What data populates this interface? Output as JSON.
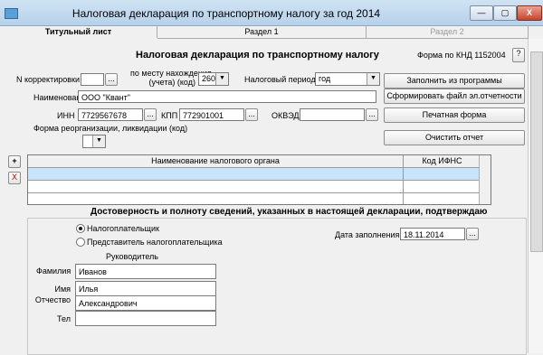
{
  "window": {
    "title": "Налоговая декларация по транспортному налогу за год 2014",
    "buttons": {
      "minimize": "—",
      "restore": "▢",
      "close": "X"
    }
  },
  "tabs": [
    {
      "label": "Титульный лист",
      "state": "active"
    },
    {
      "label": "Раздел 1",
      "state": "normal"
    },
    {
      "label": "Раздел 2",
      "state": "disabled"
    }
  ],
  "form": {
    "heading": "Налоговая декларация по транспортному налогу",
    "knd": "Форма по КНД 1152004",
    "help_label": "?",
    "n_corr_label": "N корректировки",
    "n_corr_value": "",
    "ellipsis": "...",
    "location_label_1": "по месту нахождения",
    "location_label_2": "(учета) (код)",
    "location_value": "260",
    "period_label": "Налоговый период",
    "period_value": "год",
    "name_label": "Наименование",
    "name_value": "ООО \"Квант\"",
    "inn_label": "ИНН",
    "inn_value": "7729567678",
    "kpp_label": "КПП",
    "kpp_value": "772901001",
    "okved_label": "ОКВЭД",
    "okved_value": "",
    "reorg_label": "Форма реорганизации, ликвидации (код)",
    "reorg_value": ""
  },
  "actions": {
    "fill": "Заполнить из программы",
    "generate": "Сформировать файл эл.отчетности",
    "print": "Печатная форма",
    "clear": "Очистить отчет"
  },
  "grid": {
    "add": "+",
    "delete": "X",
    "col1": "Наименование налогового органа",
    "col2": "Код ИФНС"
  },
  "confirm": {
    "heading": "Достоверность и полноту сведений, указанных в настоящей декларации, подтверждаю",
    "radio1": "Налогоплательщик",
    "radio2": "Представитель налогоплательщика",
    "date_label": "Дата заполнения",
    "date_value": "18.11.2014",
    "head_label": "Руководитель",
    "surname_label": "Фамилия",
    "surname_value": "Иванов",
    "name_label": "Имя",
    "name_value": "Илья",
    "patronymic_label": "Отчество",
    "patronymic_value": "Александрович",
    "tel_label": "Тел",
    "tel_value": ""
  }
}
